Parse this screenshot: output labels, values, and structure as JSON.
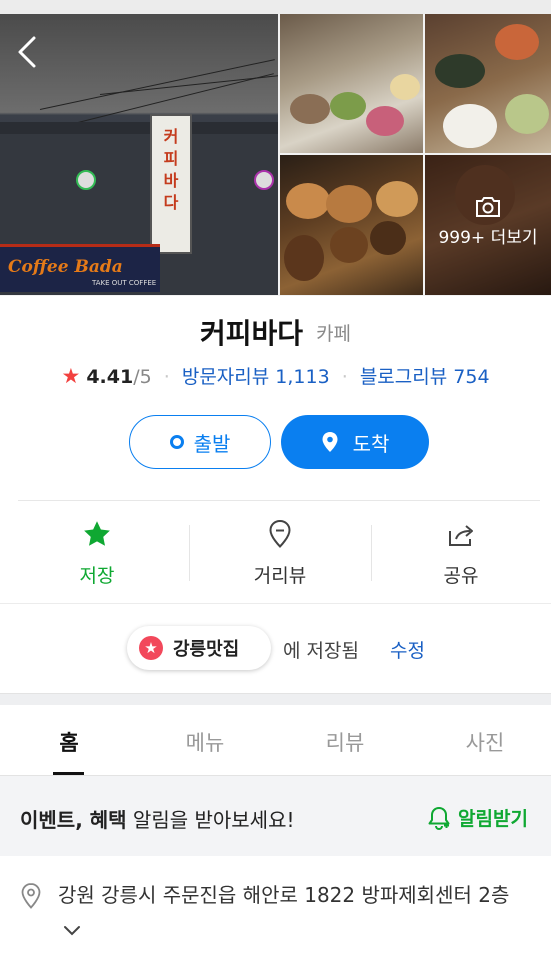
{
  "header": {
    "more_photos_label": "999+ 더보기"
  },
  "place": {
    "name": "커피바다",
    "category": "카페",
    "rating": "4.41",
    "rating_max": "/5",
    "visitor_reviews_label": "방문자리뷰 1,113",
    "blog_reviews_label": "블로그리뷰 754"
  },
  "route": {
    "start_label": "출발",
    "arrive_label": "도착"
  },
  "actions": {
    "save_label": "저장",
    "streetview_label": "거리뷰",
    "share_label": "공유"
  },
  "saved": {
    "list_name": "강릉맛집",
    "note": "에 저장됨",
    "edit_label": "수정"
  },
  "tabs": [
    {
      "label": "홈",
      "active": true
    },
    {
      "label": "메뉴",
      "active": false
    },
    {
      "label": "리뷰",
      "active": false
    },
    {
      "label": "사진",
      "active": false
    }
  ],
  "notice": {
    "text_bold": "이벤트, 혜택",
    "text_rest": " 알림을 받아보세요!",
    "button_label": "알림받기"
  },
  "address": {
    "text": "강원 강릉시 주문진읍 해안로 1822 방파제회센터 2층"
  },
  "colors": {
    "primary_blue": "#0a7ff0",
    "link_blue": "#1a60c4",
    "green": "#0fa832",
    "star_red": "#f2413f"
  },
  "icons": {
    "back": "chevron-left-icon",
    "camera": "camera-icon",
    "start": "ring-icon",
    "arrive": "map-pin-icon",
    "save": "star-icon",
    "streetview": "location-pin-icon",
    "share": "share-icon",
    "notify": "bell-icon",
    "address": "location-pin-icon"
  }
}
